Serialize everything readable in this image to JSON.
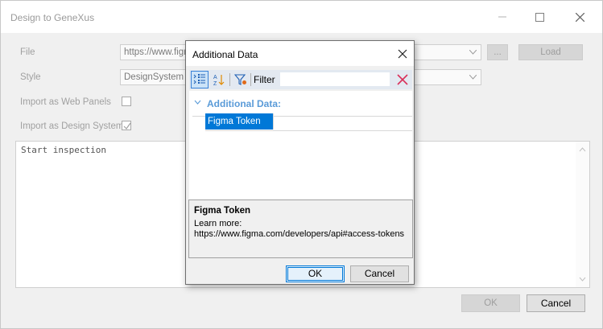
{
  "window": {
    "title": "Design to GeneXus",
    "minimize_icon": "minimize-icon",
    "maximize_icon": "maximize-icon",
    "close_icon": "close-icon"
  },
  "form": {
    "file_label": "File",
    "file_value": "https://www.figma",
    "browse_label": "...",
    "load_label": "Load",
    "style_label": "Style",
    "style_value": "DesignSystem",
    "web_panels_label": "Import as Web Panels",
    "web_panels_checked": false,
    "design_system_label": "Import as Design System",
    "design_system_checked": true
  },
  "log": {
    "text": "Start inspection"
  },
  "footer": {
    "ok_label": "OK",
    "cancel_label": "Cancel"
  },
  "dialog": {
    "title": "Additional Data",
    "toolbar": {
      "categorized_icon": "categorized-view-icon",
      "alphabetical_icon": "sort-alphabetical-icon",
      "filter_icon": "filter-icon",
      "filter_label": "Filter",
      "filter_value": "",
      "clear_icon": "clear-filter-icon"
    },
    "category": "Additional Data:",
    "properties": [
      {
        "name": "Figma Token",
        "value": ""
      }
    ],
    "help": {
      "title": "Figma Token",
      "line1": "Learn more:",
      "line2": "https://www.figma.com/developers/api#access-tokens"
    },
    "ok_label": "OK",
    "cancel_label": "Cancel"
  },
  "colors": {
    "accent": "#0078d7",
    "category_text": "#5a9bd8",
    "clear_icon": "#d9305a"
  }
}
